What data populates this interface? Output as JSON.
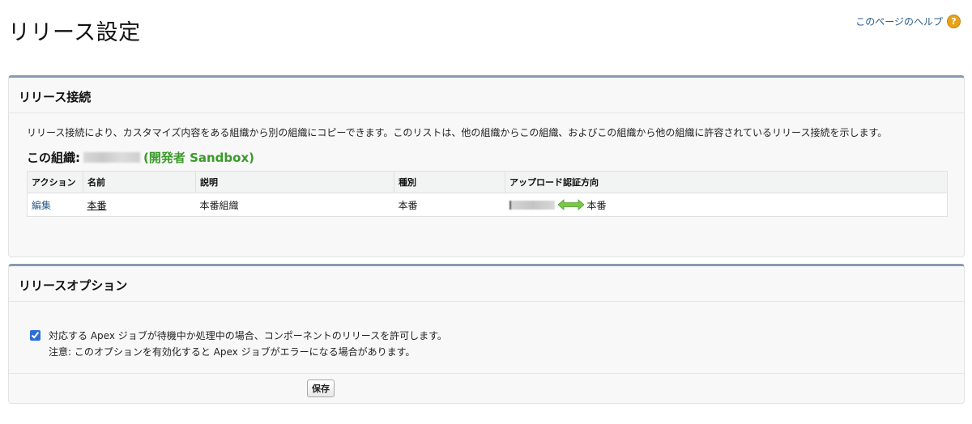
{
  "page": {
    "title": "リリース設定",
    "help_label": "このページのヘルプ",
    "help_icon": "question-icon"
  },
  "connection": {
    "header": "リリース接続",
    "description": "リリース接続により、カスタマイズ内容をある組織から別の組織にコピーできます。このリストは、他の組織からこの組織、およびこの組織から他の組織に許容されているリリース接続を示します。",
    "org_label": "この組織:",
    "org_type": "(開発者 Sandbox)",
    "table": {
      "columns": [
        "アクション",
        "名前",
        "説明",
        "種別",
        "アップロード認証方向"
      ],
      "rows": [
        {
          "action": "編集",
          "name": "本番",
          "description": "本番組織",
          "type": "本番",
          "direction_target": "本番"
        }
      ]
    },
    "colors": {
      "org_type": "#3a9a2a",
      "link": "#2a5d8a",
      "panel_border": "#8a9ab0"
    }
  },
  "options": {
    "header": "リリースオプション",
    "checkbox_checked": true,
    "checkbox_label": "対応する Apex ジョブが待機中か処理中の場合、コンポーネントのリリースを許可します。",
    "note": "注意: このオプションを有効化すると Apex ジョブがエラーになる場合があります。",
    "save_label": "保存"
  }
}
